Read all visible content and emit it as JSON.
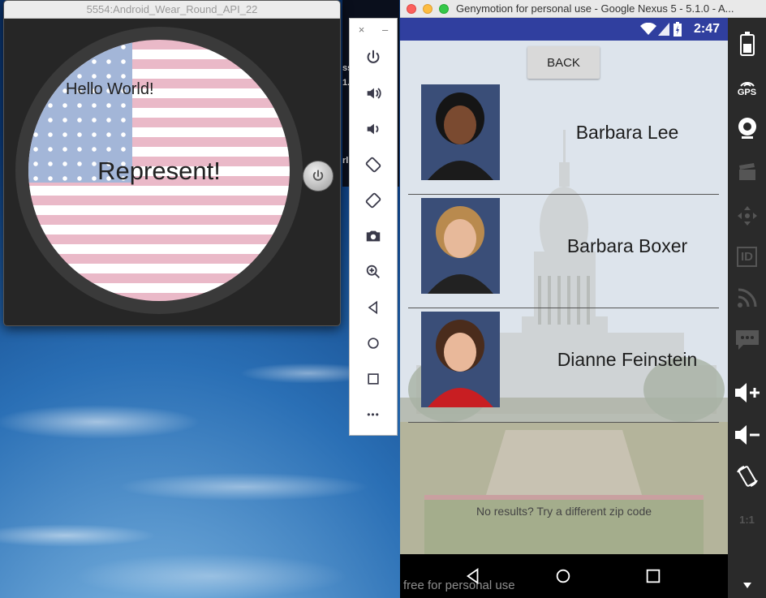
{
  "wear": {
    "window_title": "5554:Android_Wear_Round_API_22",
    "hello": "Hello World!",
    "title": "Represent!"
  },
  "toolbar": {
    "close": "×",
    "minimize": "–",
    "more": "•••"
  },
  "desktop": {
    "fragment1": "ss",
    "fragment2": "1.",
    "fragment3": "rl"
  },
  "genymotion": {
    "window_title": "Genymotion for personal use - Google Nexus 5 - 5.1.0 - A...",
    "status_time": "2:47",
    "back_label": "BACK",
    "reps": [
      {
        "name": "Barbara Lee",
        "suit": "#1b1b1b",
        "skin": "#7a4a30",
        "hair": "#151515"
      },
      {
        "name": "Barbara Boxer",
        "suit": "#222222",
        "skin": "#e7b99a",
        "hair": "#b98a4e"
      },
      {
        "name": "Dianne Feinstein",
        "suit": "#c81e22",
        "skin": "#e9b89a",
        "hair": "#4a2c1c"
      }
    ],
    "no_results": "No results?  Try a different zip code",
    "watermark": "free for personal use",
    "gps_label": "GPS",
    "id_label": "ID",
    "ratio_label": "1:1"
  },
  "colors": {
    "statusbar": "#303f9f",
    "accent_green": "#7ed321"
  }
}
